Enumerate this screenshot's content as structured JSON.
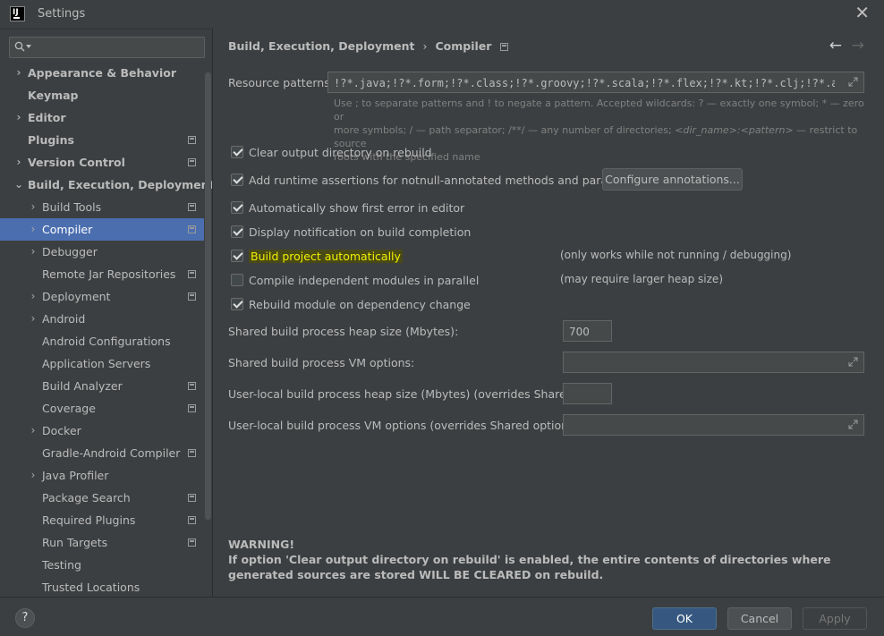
{
  "window": {
    "title": "Settings",
    "logo_text": "IJ"
  },
  "sidebar": {
    "search": {
      "placeholder": "",
      "value": ""
    },
    "items": [
      {
        "label": "Appearance & Behavior",
        "bold": true,
        "arrow": "›",
        "level": 0
      },
      {
        "label": "Keymap",
        "bold": true,
        "arrow": "",
        "level": 0
      },
      {
        "label": "Editor",
        "bold": true,
        "arrow": "›",
        "level": 0
      },
      {
        "label": "Plugins",
        "bold": true,
        "arrow": "",
        "level": 0,
        "project": true
      },
      {
        "label": "Version Control",
        "bold": true,
        "arrow": "›",
        "level": 0,
        "project": true
      },
      {
        "label": "Build, Execution, Deployment",
        "bold": true,
        "arrow": "⌄",
        "level": 0
      },
      {
        "label": "Build Tools",
        "arrow": "›",
        "level": 1,
        "project": true
      },
      {
        "label": "Compiler",
        "arrow": "›",
        "level": 1,
        "project": true,
        "selected": true
      },
      {
        "label": "Debugger",
        "arrow": "›",
        "level": 1
      },
      {
        "label": "Remote Jar Repositories",
        "arrow": "",
        "level": 1,
        "project": true
      },
      {
        "label": "Deployment",
        "arrow": "›",
        "level": 1,
        "project": true
      },
      {
        "label": "Android",
        "arrow": "›",
        "level": 1
      },
      {
        "label": "Android Configurations",
        "arrow": "",
        "level": 1
      },
      {
        "label": "Application Servers",
        "arrow": "",
        "level": 1
      },
      {
        "label": "Build Analyzer",
        "arrow": "",
        "level": 1,
        "project": true
      },
      {
        "label": "Coverage",
        "arrow": "",
        "level": 1,
        "project": true
      },
      {
        "label": "Docker",
        "arrow": "›",
        "level": 1
      },
      {
        "label": "Gradle-Android Compiler",
        "arrow": "",
        "level": 1,
        "project": true
      },
      {
        "label": "Java Profiler",
        "arrow": "›",
        "level": 1
      },
      {
        "label": "Package Search",
        "arrow": "",
        "level": 1,
        "project": true
      },
      {
        "label": "Required Plugins",
        "arrow": "",
        "level": 1,
        "project": true
      },
      {
        "label": "Run Targets",
        "arrow": "",
        "level": 1,
        "project": true
      },
      {
        "label": "Testing",
        "arrow": "",
        "level": 1
      },
      {
        "label": "Trusted Locations",
        "arrow": "",
        "level": 1
      }
    ]
  },
  "breadcrumb": {
    "parent": "Build, Execution, Deployment",
    "separator": "›",
    "current": "Compiler"
  },
  "nav": {
    "back": "←",
    "forward": "→"
  },
  "resource_patterns": {
    "label": "Resource patterns:",
    "value": "!?*.java;!?*.form;!?*.class;!?*.groovy;!?*.scala;!?*.flex;!?*.kt;!?*.clj;!?*.aj",
    "hint_1": "Use ; to separate patterns and ! to negate a pattern. Accepted wildcards: ? — exactly one symbol; * — zero or",
    "hint_2": "more symbols; / — path separator; /**/ — any number of directories; ",
    "hint_dir": "<dir_name>:<pattern>",
    "hint_3": " — restrict to source",
    "hint_4": "roots with the specified name"
  },
  "options": {
    "clear_output": {
      "label": "Clear output directory on rebuild",
      "checked": true
    },
    "runtime_assertions": {
      "label": "Add runtime assertions for notnull-annotated methods and parameters",
      "checked": true
    },
    "configure_annotations": "Configure annotations...",
    "show_first_error": {
      "label": "Automatically show first error in editor",
      "checked": true
    },
    "display_notification": {
      "label": "Display notification on build completion",
      "checked": true
    },
    "build_automatically": {
      "label": "Build project automatically",
      "checked": true,
      "note": "(only works while not running / debugging)"
    },
    "compile_parallel": {
      "label": "Compile independent modules in parallel",
      "checked": false,
      "note": "(may require larger heap size)"
    },
    "rebuild_on_change": {
      "label": "Rebuild module on dependency change",
      "checked": true
    }
  },
  "heap": {
    "label": "Shared build process heap size (Mbytes):",
    "value": "700"
  },
  "vm_options": {
    "label": "Shared build process VM options:",
    "value": ""
  },
  "local_heap": {
    "label": "User-local build process heap size (Mbytes) (overrides Shared size):",
    "value": ""
  },
  "local_vm": {
    "label": "User-local build process VM options (overrides Shared options):",
    "value": ""
  },
  "warning": {
    "title": "WARNING!",
    "text": "If option 'Clear output directory on rebuild' is enabled, the entire contents of directories where generated sources are stored WILL BE CLEARED on rebuild."
  },
  "footer": {
    "help": "?",
    "ok": "OK",
    "cancel": "Cancel",
    "apply": "Apply"
  },
  "colors": {
    "background": "#3c3f41",
    "selection": "#4b6eaf",
    "primary_button": "#365880",
    "highlight": "#f0f000"
  }
}
